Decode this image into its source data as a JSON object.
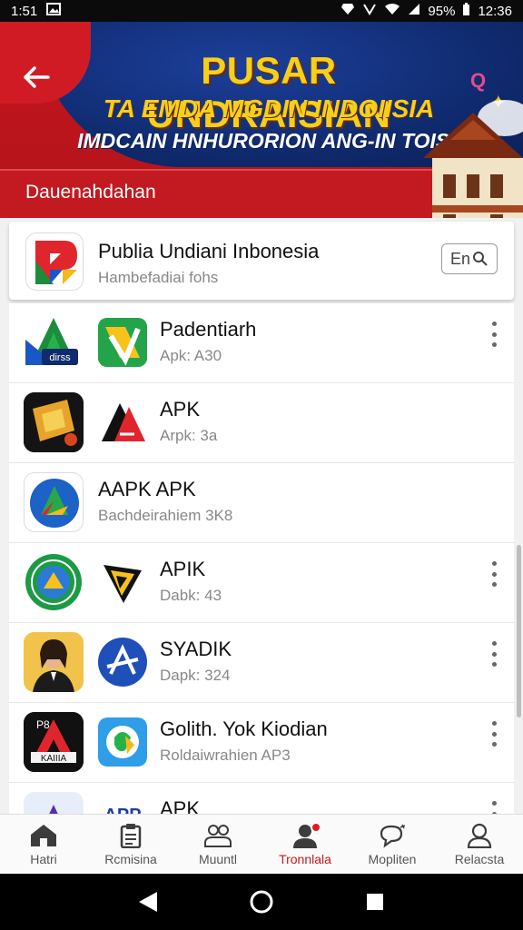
{
  "status_bar": {
    "time_left": "1:51",
    "battery": "95%",
    "time_right": "12:36"
  },
  "banner": {
    "title": "PUSAR UNDRAISIAN",
    "subtitle1": "TA EMDA MGDIN INDOIISIA",
    "subtitle2": "IMDCAIN HNHURORION ANG-IN TOIS!",
    "band_text": "Dauenahdahan",
    "badge": "Q"
  },
  "featured": {
    "title": "Publia Undiani Inbonesia",
    "subtitle": "Hambefadiai fohs",
    "search_label": "En"
  },
  "apps": [
    {
      "title": "Padentiarh",
      "subtitle": "Apk: A30",
      "icon_left_text": "dirss"
    },
    {
      "title": "APK",
      "subtitle": "Arpk: 3a"
    },
    {
      "title": "AAPK APK",
      "subtitle": "Bachdeirahiem 3K8"
    },
    {
      "title": "APIK",
      "subtitle": "Dabk: 43"
    },
    {
      "title": "SYADIK",
      "subtitle": "Dapk: 324"
    },
    {
      "title": "Golith. Yok Kiodian",
      "subtitle": "Roldaiwrahien AP3",
      "icon_left_text": "P8",
      "icon_left_sub": "KAIIIA"
    },
    {
      "title": "APK",
      "subtitle": "",
      "icon_small_text": "APP"
    }
  ],
  "bottom_nav": [
    {
      "label": "Hatri",
      "icon": "home-icon"
    },
    {
      "label": "Rcmisina",
      "icon": "clipboard-icon"
    },
    {
      "label": "Muuntl",
      "icon": "people-icon"
    },
    {
      "label": "Tronnlala",
      "icon": "person-icon",
      "active": true
    },
    {
      "label": "Mopliten",
      "icon": "chat-icon"
    },
    {
      "label": "Relacsta",
      "icon": "profile-icon"
    }
  ],
  "colors": {
    "accent": "#c21a20",
    "banner_blue": "#0f2a6e",
    "gold": "#f6cf1b"
  }
}
